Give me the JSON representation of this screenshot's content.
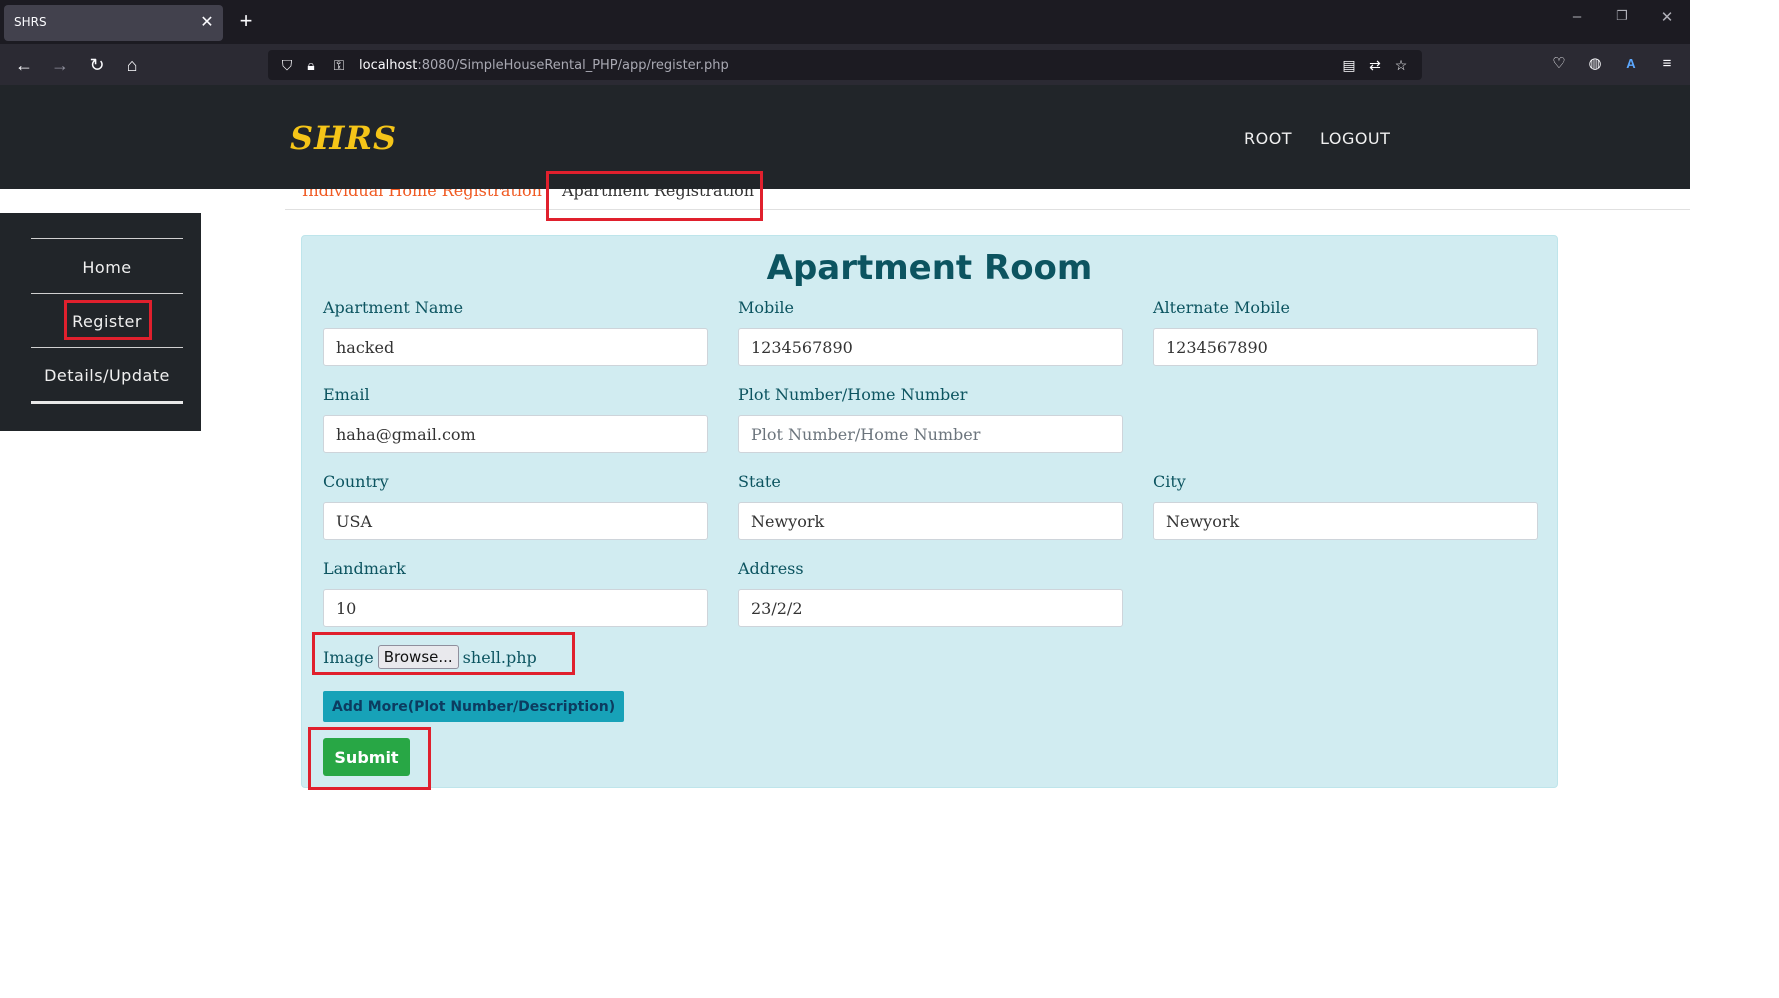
{
  "browser": {
    "tab_title": "SHRS",
    "tab_close": "✕",
    "new_tab": "+",
    "url_host": "localhost",
    "url_rest": ":8080/SimpleHouseRental_PHP/app/register.php",
    "icons": [
      "back-icon",
      "forward-icon",
      "reload-icon",
      "home-icon",
      "shield-icon",
      "lock-icon",
      "key-icon",
      "reader-icon",
      "translate-icon",
      "bookmark-star-icon",
      "pocket-icon",
      "globe-icon",
      "translate-ext-icon",
      "menu-icon"
    ]
  },
  "site": {
    "brand": "SHRS",
    "nav": [
      "ROOT",
      "LOGOUT"
    ]
  },
  "tabs": {
    "individual": "Individual Home Registration",
    "apartment": "Apartment Registration"
  },
  "sidebar": {
    "items": [
      "Home",
      "Register",
      "Details/Update"
    ]
  },
  "form": {
    "title": "Apartment Room",
    "fields": {
      "apartment_name": {
        "label": "Apartment Name",
        "value": "hacked"
      },
      "mobile": {
        "label": "Mobile",
        "value": "1234567890"
      },
      "alt_mobile": {
        "label": "Alternate Mobile",
        "value": "1234567890"
      },
      "email": {
        "label": "Email",
        "value": "haha@gmail.com"
      },
      "plot": {
        "label": "Plot Number/Home Number",
        "value": "",
        "placeholder": "Plot Number/Home Number"
      },
      "country": {
        "label": "Country",
        "value": "USA"
      },
      "state": {
        "label": "State",
        "value": "Newyork"
      },
      "city": {
        "label": "City",
        "value": "Newyork"
      },
      "landmark": {
        "label": "Landmark",
        "value": "10"
      },
      "address": {
        "label": "Address",
        "value": "23/2/2"
      }
    },
    "image_label": "Image",
    "browse_label": "Browse...",
    "file_name": "shell.php",
    "add_more_label": "Add More(Plot Number/Description)",
    "submit_label": "Submit"
  },
  "colors": {
    "highlight": "#e0202d",
    "brand": "#f5c518",
    "card_bg": "#d1ecf1",
    "card_text": "#0c5460",
    "submit": "#28a745",
    "add_more": "#17a2b8"
  }
}
